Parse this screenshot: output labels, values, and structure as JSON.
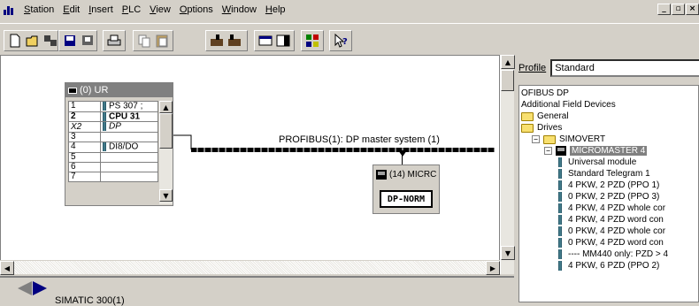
{
  "menu": [
    {
      "label": "Station",
      "u": "S"
    },
    {
      "label": "Edit",
      "u": "E"
    },
    {
      "label": "Insert",
      "u": "I"
    },
    {
      "label": "PLC",
      "u": "P"
    },
    {
      "label": "View",
      "u": "V"
    },
    {
      "label": "Options",
      "u": "O"
    },
    {
      "label": "Window",
      "u": "W"
    },
    {
      "label": "Help",
      "u": "H"
    }
  ],
  "window_controls": [
    "_",
    "̸",
    "×"
  ],
  "toolbar": {
    "icons": [
      "new-icon",
      "open-icon",
      "save-compile-icon",
      "save-icon",
      "download-icon",
      "print-icon",
      "copy-icon",
      "paste-icon",
      "download-module-icon",
      "upload-module-icon",
      "table-view-icon",
      "catalog-icon",
      "network-icon",
      "help-icon"
    ]
  },
  "rack": {
    "title": "(0) UR",
    "rows": [
      {
        "slot": "1",
        "module": "PS 307 ;",
        "icon": true
      },
      {
        "slot": "2",
        "module": "CPU 31",
        "icon": true,
        "bold": true
      },
      {
        "slot": "X2",
        "module": "DP",
        "icon": true,
        "italic": true
      },
      {
        "slot": "3",
        "module": "",
        "icon": false
      },
      {
        "slot": "4",
        "module": "DI8/DO",
        "icon": true
      },
      {
        "slot": "5",
        "module": "",
        "icon": false
      },
      {
        "slot": "6",
        "module": "",
        "icon": false
      },
      {
        "slot": "7",
        "module": "",
        "icon": false
      }
    ]
  },
  "bus": {
    "label": "PROFIBUS(1): DP master system (1)"
  },
  "slave": {
    "title": "(14) MICRC",
    "button": "DP-NORM"
  },
  "bottom": {
    "station": "SIMATIC 300(1)"
  },
  "catalog": {
    "profile_label": "Profile",
    "profile_value": "Standard",
    "tree": [
      {
        "label": "OFIBUS DP",
        "depth": 0,
        "kind": "text"
      },
      {
        "label": "Additional Field Devices",
        "depth": 0,
        "kind": "text"
      },
      {
        "label": "General",
        "depth": 0,
        "kind": "folder"
      },
      {
        "label": "Drives",
        "depth": 0,
        "kind": "folder"
      },
      {
        "label": "SIMOVERT",
        "depth": 1,
        "kind": "folder-expand"
      },
      {
        "label": "MICROMASTER 4",
        "depth": 2,
        "kind": "device-selected"
      },
      {
        "label": "Universal module",
        "depth": 3,
        "kind": "module"
      },
      {
        "label": "Standard Telegram 1",
        "depth": 3,
        "kind": "module"
      },
      {
        "label": "4 PKW,  2 PZD  (PPO 1)",
        "depth": 3,
        "kind": "module"
      },
      {
        "label": "0 PKW,  2 PZD  (PPO 3)",
        "depth": 3,
        "kind": "module"
      },
      {
        "label": "4 PKW,  4 PZD whole cor",
        "depth": 3,
        "kind": "module"
      },
      {
        "label": "4 PKW,  4 PZD word con",
        "depth": 3,
        "kind": "module"
      },
      {
        "label": "0 PKW,  4 PZD whole cor",
        "depth": 3,
        "kind": "module"
      },
      {
        "label": "0 PKW,  4 PZD word con",
        "depth": 3,
        "kind": "module"
      },
      {
        "label": "---- MM440 only: PZD > 4",
        "depth": 3,
        "kind": "module"
      },
      {
        "label": "4 PKW, 6 PZD (PPO 2)",
        "depth": 3,
        "kind": "module"
      }
    ]
  }
}
